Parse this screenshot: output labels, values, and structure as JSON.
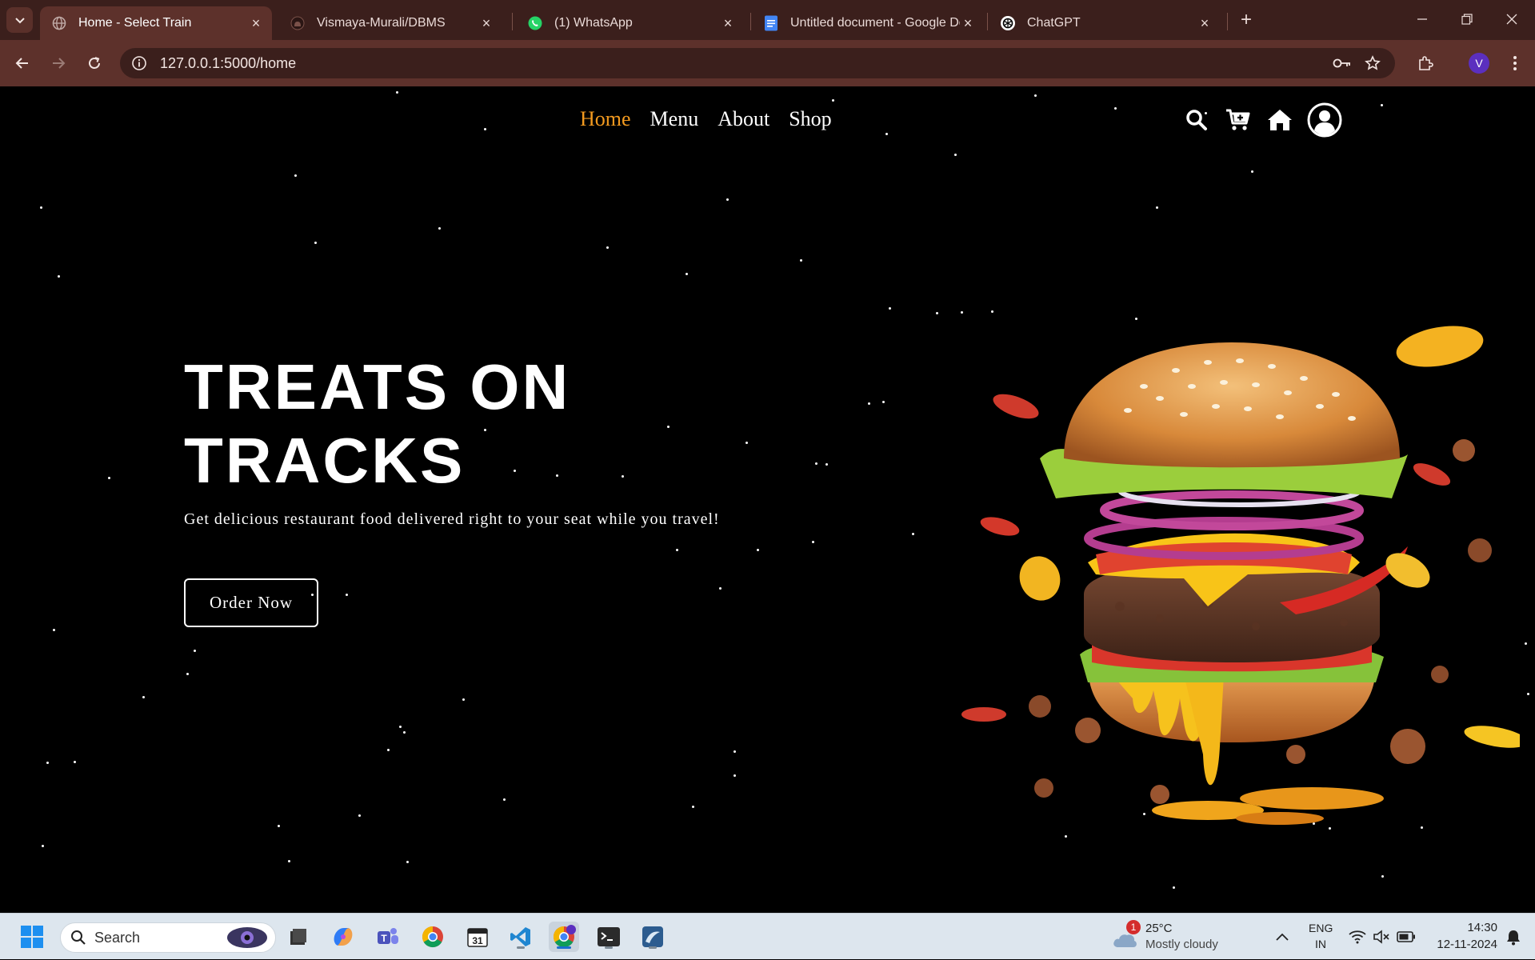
{
  "browser": {
    "tabs": [
      {
        "label": "Home - Select Train",
        "icon": "globe-icon",
        "active": true
      },
      {
        "label": "Vismaya-Murali/DBMS",
        "icon": "github-icon",
        "active": false
      },
      {
        "label": "(1) WhatsApp",
        "icon": "whatsapp-icon",
        "active": false
      },
      {
        "label": "Untitled document - Google Do",
        "icon": "google-docs-icon",
        "active": false
      },
      {
        "label": "ChatGPT",
        "icon": "chatgpt-icon",
        "active": false
      }
    ],
    "address": "127.0.0.1:5000/home",
    "profile_initial": "V"
  },
  "site": {
    "nav": [
      {
        "label": "Home",
        "active": true
      },
      {
        "label": "Menu",
        "active": false
      },
      {
        "label": "About",
        "active": false
      },
      {
        "label": "Shop",
        "active": false
      }
    ],
    "nav_icons": [
      "search-icon",
      "cart-plus-icon",
      "home-icon",
      "user-icon"
    ],
    "hero": {
      "title_line1": "TREATS ON",
      "title_line2": "TRACKS",
      "subtitle": "Get delicious restaurant food delivered right to your seat while you travel!",
      "cta": "Order Now"
    },
    "colors": {
      "accent": "#f39a1f",
      "background": "#000000",
      "text": "#ffffff"
    }
  },
  "taskbar": {
    "search_label": "Search",
    "apps": [
      "file-explorer-icon",
      "copilot-icon",
      "teams-icon",
      "chrome-icon",
      "calendar-icon",
      "vscode-icon",
      "chrome-profile-icon",
      "terminal-icon",
      "mysql-workbench-icon"
    ],
    "calendar_day": "31",
    "weather": {
      "temp": "25°C",
      "condition": "Mostly cloudy",
      "badge": "1"
    },
    "language": {
      "line1": "ENG",
      "line2": "IN"
    },
    "time": "14:30",
    "date": "12-11-2024"
  }
}
